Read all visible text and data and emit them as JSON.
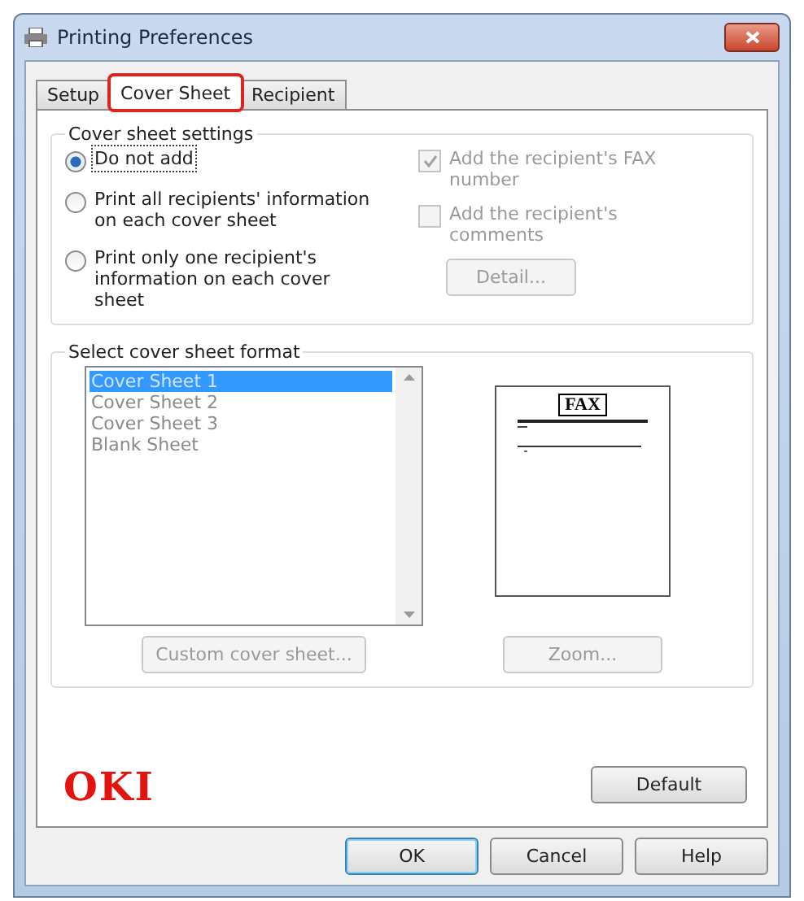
{
  "window": {
    "title": "Printing Preferences"
  },
  "tabs": [
    {
      "label": "Setup",
      "selected": false,
      "highlighted": false
    },
    {
      "label": "Cover Sheet",
      "selected": true,
      "highlighted": true
    },
    {
      "label": "Recipient",
      "selected": false,
      "highlighted": false
    }
  ],
  "cover_sheet_settings": {
    "title": "Cover sheet settings",
    "options": [
      {
        "label": "Do not add",
        "selected": true
      },
      {
        "label": "Print all recipients' information on each cover sheet",
        "selected": false
      },
      {
        "label": "Print only one recipient's information on each cover sheet",
        "selected": false
      }
    ],
    "checkboxes": [
      {
        "label": "Add the recipient's FAX number",
        "checked": true,
        "disabled": true
      },
      {
        "label": "Add the recipient's comments",
        "checked": false,
        "disabled": true
      }
    ],
    "detail_button": {
      "label": "Detail...",
      "disabled": true
    }
  },
  "cover_sheet_format": {
    "title": "Select cover sheet format",
    "items": [
      {
        "label": "Cover Sheet 1",
        "selected": true
      },
      {
        "label": "Cover Sheet 2",
        "selected": false
      },
      {
        "label": "Cover Sheet 3",
        "selected": false
      },
      {
        "label": "Blank Sheet",
        "selected": false
      }
    ],
    "preview": {
      "heading": "FAX"
    },
    "custom_button": {
      "label": "Custom cover sheet...",
      "disabled": true
    },
    "zoom_button": {
      "label": "Zoom...",
      "disabled": true
    }
  },
  "logo": "OKI",
  "default_button": {
    "label": "Default",
    "disabled": false
  },
  "buttons": [
    {
      "label": "OK",
      "selected": true
    },
    {
      "label": "Cancel",
      "selected": false
    },
    {
      "label": "Help",
      "selected": false
    }
  ]
}
